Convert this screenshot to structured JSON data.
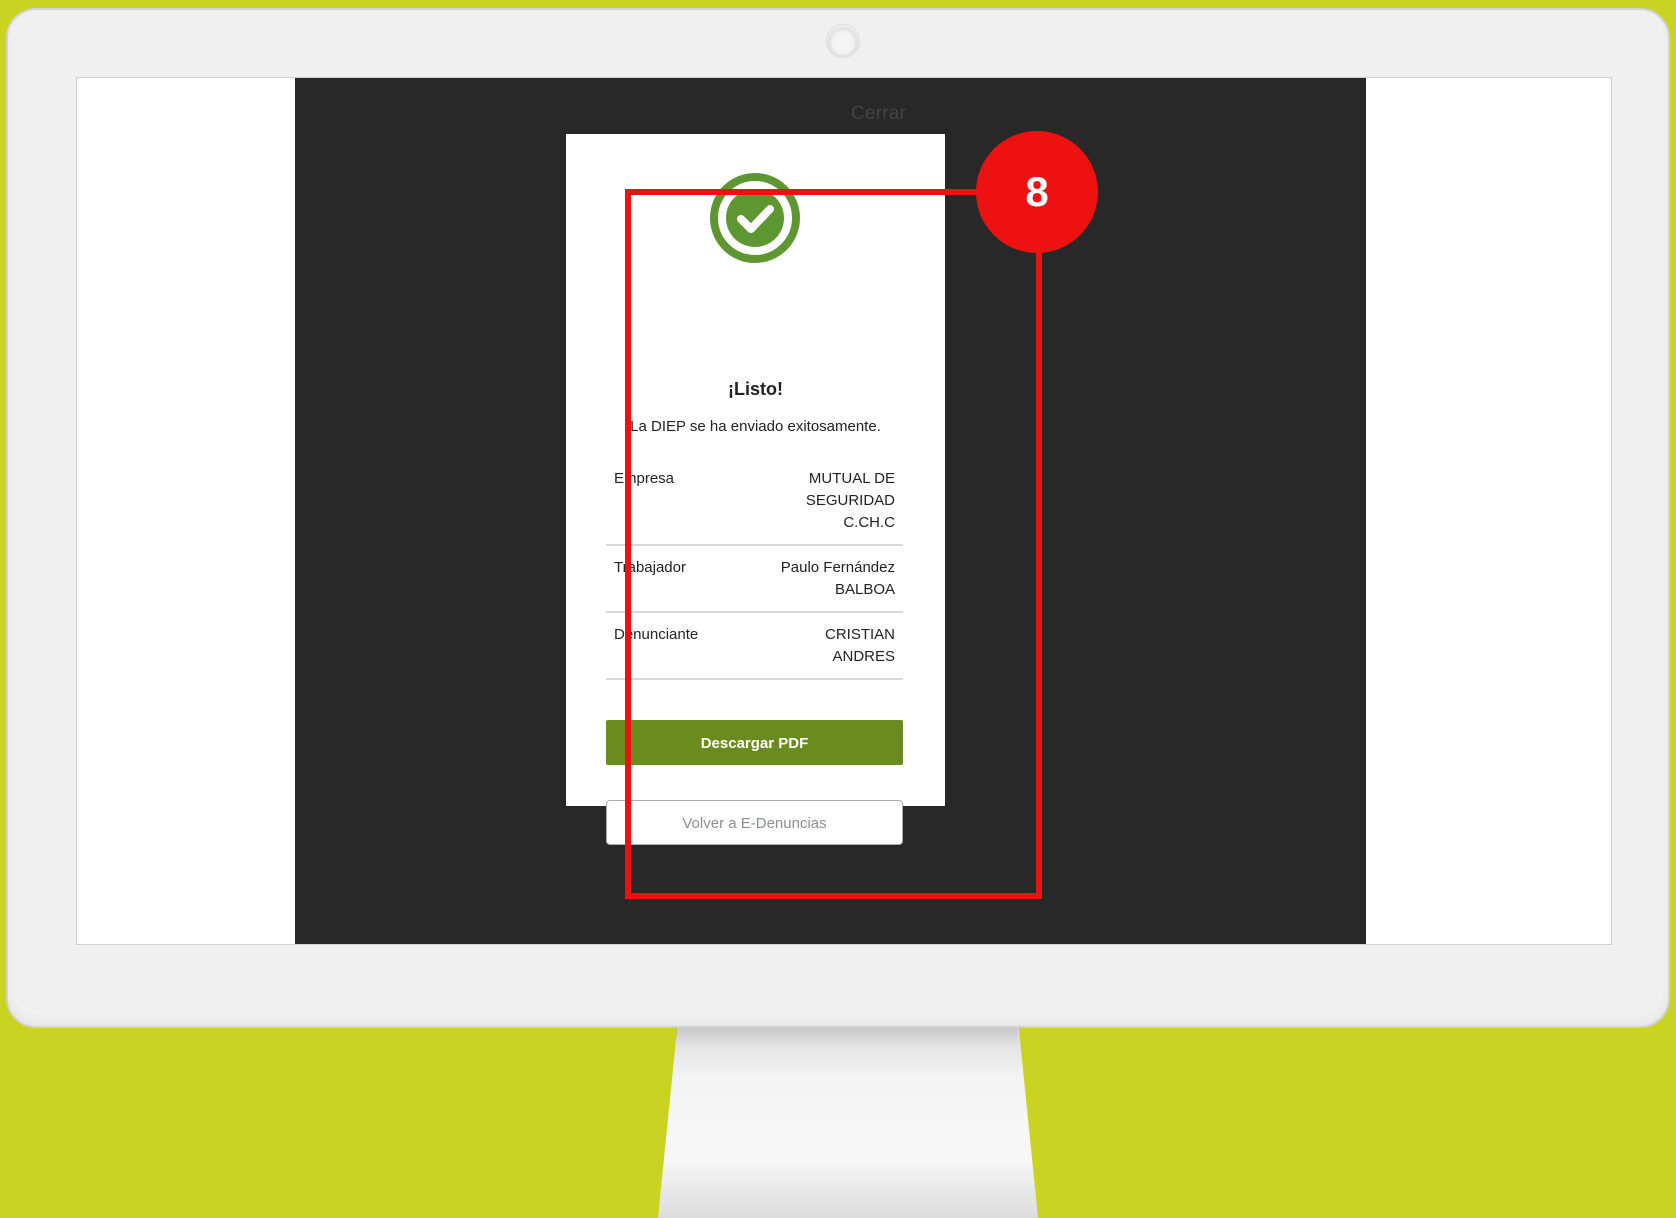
{
  "modal": {
    "close_label": "Cerrar",
    "title": "¡Listo!",
    "message": "La DIEP se ha enviado exitosamente.",
    "details": [
      {
        "label": "Empresa",
        "value": "MUTUAL DE SEGURIDAD C.CH.C"
      },
      {
        "label": "Trabajador",
        "value": "Paulo Fernández BALBOA"
      },
      {
        "label": "Denunciante",
        "value": "CRISTIAN ANDRES"
      }
    ],
    "primary_button": "Descargar PDF",
    "secondary_button": "Volver a E-Denuncias",
    "icon": "check-circle-icon"
  },
  "tutorial": {
    "step_number": "8"
  },
  "colors": {
    "background": "#cbd322",
    "overlay": "#282828",
    "success_green": "#5e9632",
    "primary_button": "#6a8c1f",
    "highlight_red": "#ee1111"
  }
}
